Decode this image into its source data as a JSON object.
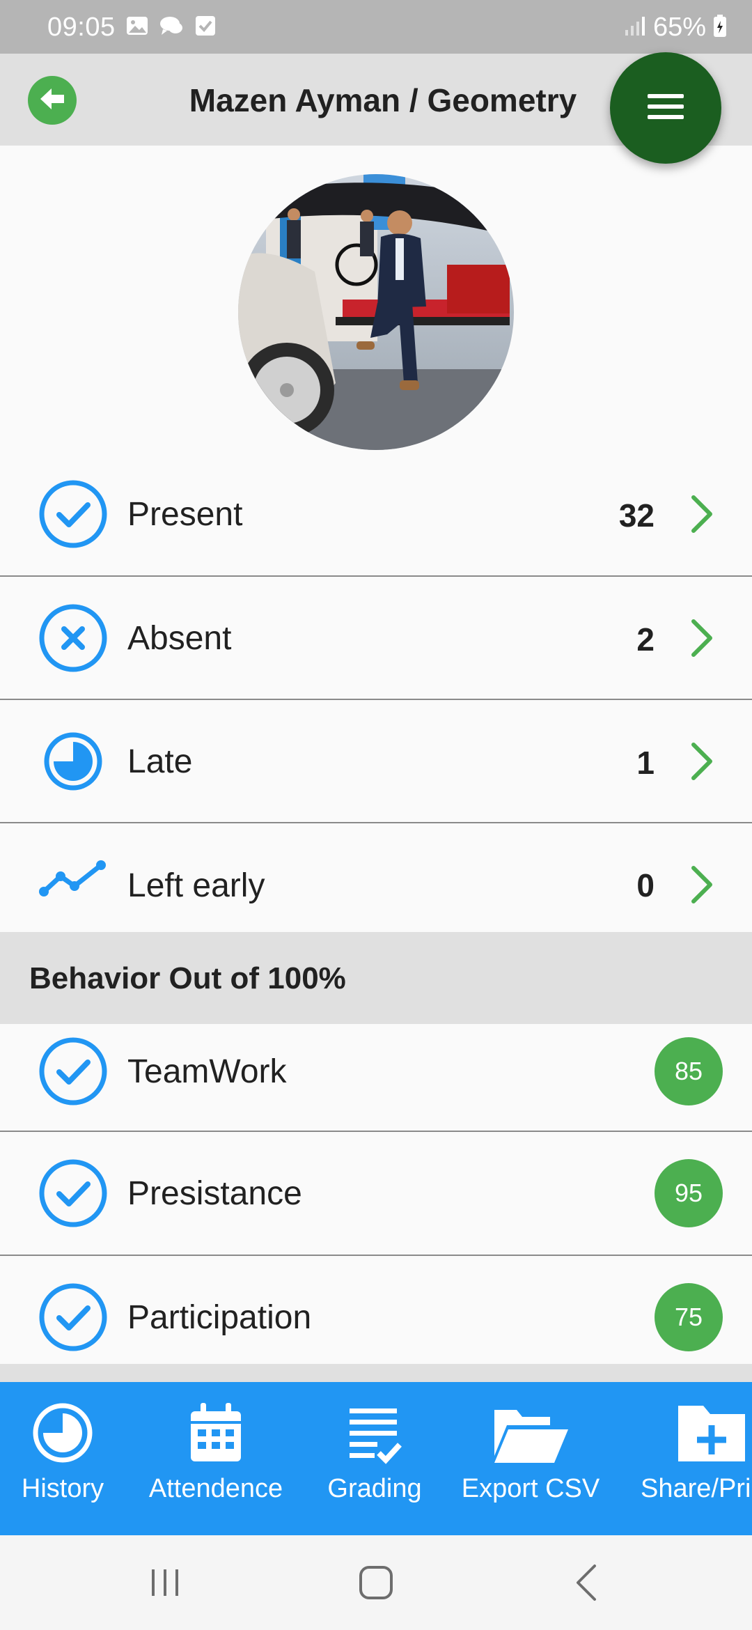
{
  "status_bar": {
    "time": "09:05",
    "battery": "65%",
    "notification_icons": [
      "image-icon",
      "chat-icon",
      "checkbox-icon"
    ]
  },
  "header": {
    "title": "Mazen Ayman / Geometry",
    "back_icon": "arrow-left-circle-icon",
    "menu_icon": "hamburger-menu-icon"
  },
  "attendance": [
    {
      "label": "Present",
      "count": "32",
      "icon": "check-circle-icon"
    },
    {
      "label": "Absent",
      "count": "2",
      "icon": "x-circle-icon"
    },
    {
      "label": "Late",
      "count": "1",
      "icon": "clock-pie-icon"
    },
    {
      "label": "Left early",
      "count": "0",
      "icon": "trend-line-icon"
    }
  ],
  "behavior": {
    "title": "Behavior Out of 100%",
    "items": [
      {
        "label": "TeamWork",
        "score": "85",
        "icon": "check-circle-icon"
      },
      {
        "label": "Presistance",
        "score": "95",
        "icon": "check-circle-icon"
      },
      {
        "label": "Participation",
        "score": "75",
        "icon": "check-circle-icon"
      }
    ]
  },
  "bottom_nav": [
    {
      "label": "History",
      "icon": "history-pie-icon"
    },
    {
      "label": "Attendence",
      "icon": "calendar-icon"
    },
    {
      "label": "Grading",
      "icon": "checklist-icon"
    },
    {
      "label": "Export CSV",
      "icon": "folder-open-icon"
    },
    {
      "label": "Share/Pri",
      "icon": "folder-plus-icon"
    }
  ],
  "colors": {
    "accent_blue": "#2196f3",
    "accent_green": "#4caf50",
    "fab_dark_green": "#1b5e20",
    "header_gray": "#e0e0e0",
    "status_gray": "#b5b5b5"
  }
}
